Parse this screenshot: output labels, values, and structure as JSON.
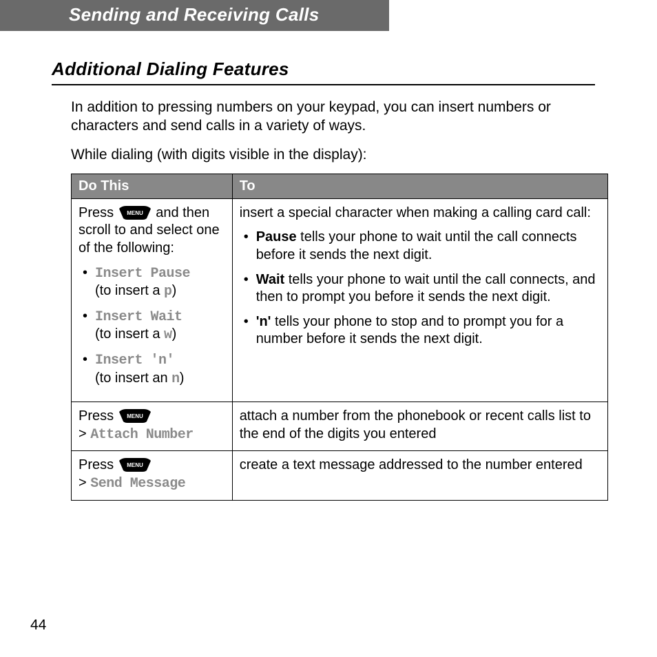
{
  "header": {
    "title": "Sending and Receiving Calls"
  },
  "section": {
    "title": "Additional Dialing Features"
  },
  "intro": {
    "p1": "In addition to pressing numbers on your keypad, you can insert numbers or characters and send calls in a variety of ways.",
    "p2": "While dialing (with digits visible in the display):"
  },
  "table": {
    "head": {
      "c1": "Do This",
      "c2": "To"
    },
    "row1": {
      "left": {
        "press": "Press ",
        "after": " and then scroll to and select one of the following:",
        "items": [
          {
            "name": "Insert Pause",
            "desc_a": "(to insert a ",
            "code": "p",
            "desc_b": ")"
          },
          {
            "name": "Insert Wait",
            "desc_a": "(to insert a ",
            "code": "w",
            "desc_b": ")"
          },
          {
            "name": "Insert 'n'",
            "desc_a": "(to insert an ",
            "code": "n",
            "desc_b": ")"
          }
        ]
      },
      "right": {
        "lead": "insert a special character when making a calling card call:",
        "items": [
          {
            "bold": "Pause",
            "rest": " tells your phone to wait until the call connects before it sends the next digit."
          },
          {
            "bold": "Wait",
            "rest": " tells your phone to wait until the call connects, and then to prompt you before it sends the next digit."
          },
          {
            "bold": "'n'",
            "rest": " tells your phone to stop and to prompt you for a number before it sends the next digit."
          }
        ]
      }
    },
    "row2": {
      "left": {
        "press": "Press ",
        "gt": ">",
        "menu_item": "Attach Number"
      },
      "right": "attach a number from the phonebook or recent calls list to the end of the digits you entered"
    },
    "row3": {
      "left": {
        "press": "Press ",
        "gt": ">",
        "menu_item": "Send Message"
      },
      "right": "create a text message addressed to the number entered"
    }
  },
  "key_label": "MENU",
  "page_number": "44"
}
